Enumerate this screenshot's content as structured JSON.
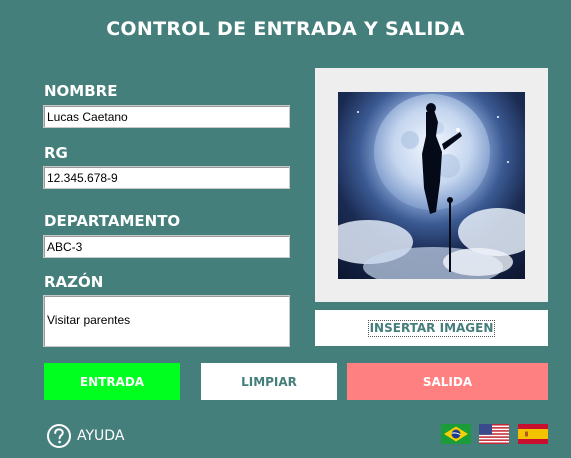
{
  "title": "CONTROL DE ENTRADA Y SALIDA",
  "form": {
    "nombre_label": "NOMBRE",
    "nombre_value": "Lucas Caetano",
    "rg_label": "RG",
    "rg_value": "12.345.678-9",
    "departamento_label": "DEPARTAMENTO",
    "departamento_value": "ABC-3",
    "razon_label": "RAZÓN",
    "razon_value": "Visitar parentes"
  },
  "image_panel": {
    "insert_button_label": "INSERTAR IMAGEN"
  },
  "buttons": {
    "entrada_label": "ENTRADA",
    "limpiar_label": "LIMPIAR",
    "salida_label": "SALIDA"
  },
  "help": {
    "label": "AYUDA",
    "icon": "question-circle-icon"
  },
  "languages": [
    {
      "name": "brazil-flag-icon"
    },
    {
      "name": "usa-flag-icon"
    },
    {
      "name": "spain-flag-icon"
    }
  ],
  "colors": {
    "background": "#457f7c",
    "entrada": "#00ff1e",
    "salida": "#ff8080",
    "accent_text": "#457f7c"
  }
}
